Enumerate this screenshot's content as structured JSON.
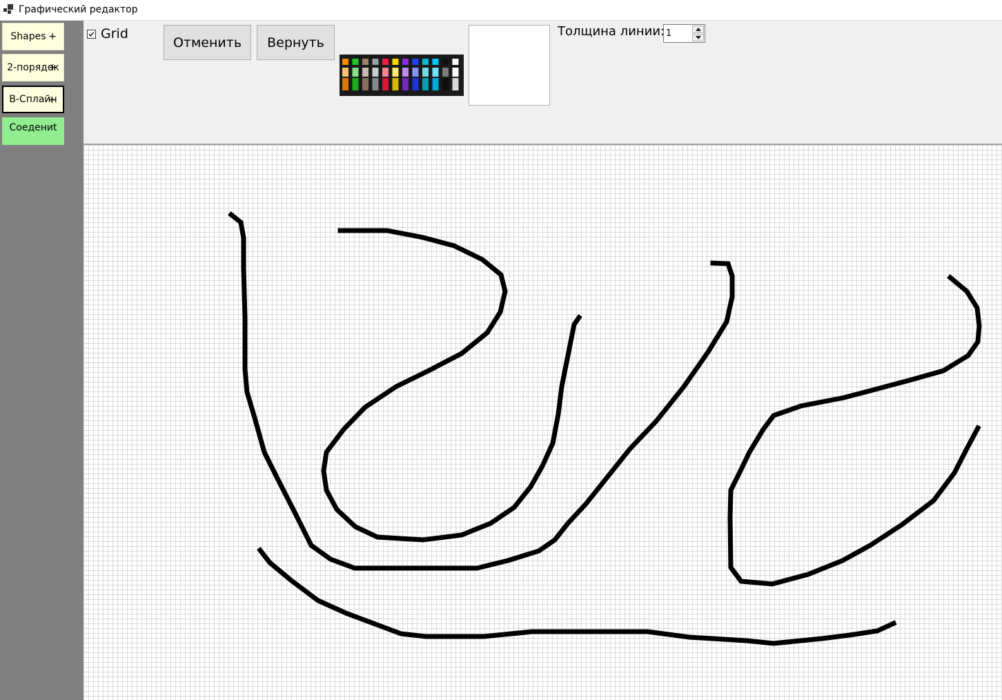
{
  "window": {
    "title": "Графический редактор",
    "icon": "app-window-icon"
  },
  "sidebar": {
    "buttons": [
      {
        "label": "Shapes",
        "suffix": "+"
      },
      {
        "label": "2-порядок",
        "suffix": "+"
      },
      {
        "label": "B-Сплайн",
        "suffix": "+"
      },
      {
        "label": "Соедениt",
        "suffix": ""
      }
    ],
    "button_color": "#ffffe0",
    "join_color": "#90ee90"
  },
  "toolbar": {
    "grid_label": "Grid",
    "grid_checked": true,
    "undo_label": "Отменить",
    "redo_label": "Вернуть",
    "thickness_label": "Толщина линии:",
    "thickness_value": "1",
    "selected_color": "#ffffff",
    "palette_colors": [
      "#ff8c00",
      "#22c922",
      "#a0826d",
      "#9aa0a6",
      "#ff1a3d",
      "#ffd800",
      "#8a2be2",
      "#1f3fff",
      "#00bcd4",
      "#00c8ff",
      "#111111",
      "#ffffff"
    ]
  },
  "canvas": {
    "grid_enabled": true,
    "stroke_color": "#000000"
  }
}
